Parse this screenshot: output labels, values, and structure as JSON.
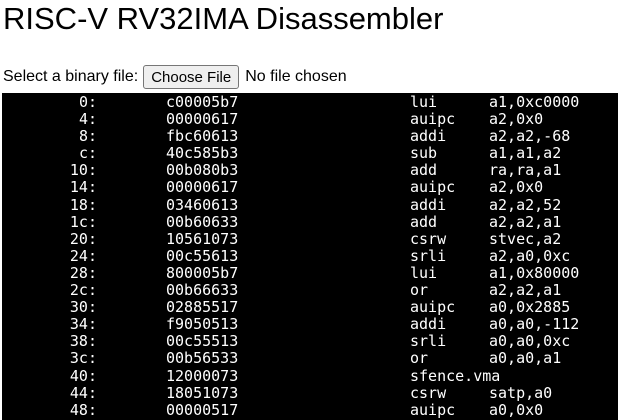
{
  "title": "RISC-V RV32IMA Disassembler",
  "file_input": {
    "label": "Select a binary file:",
    "button_label": "Choose File",
    "status": "No file chosen"
  },
  "colors": {
    "output_background": "#000000",
    "output_text": "#ffffff",
    "button_background": "#efefef"
  },
  "disassembly": [
    {
      "addr": "0:",
      "hex": "c00005b7",
      "mnemonic": "lui",
      "operands": "a1,0xc0000"
    },
    {
      "addr": "4:",
      "hex": "00000617",
      "mnemonic": "auipc",
      "operands": "a2,0x0"
    },
    {
      "addr": "8:",
      "hex": "fbc60613",
      "mnemonic": "addi",
      "operands": "a2,a2,-68"
    },
    {
      "addr": "c:",
      "hex": "40c585b3",
      "mnemonic": "sub",
      "operands": "a1,a1,a2"
    },
    {
      "addr": "10:",
      "hex": "00b080b3",
      "mnemonic": "add",
      "operands": "ra,ra,a1"
    },
    {
      "addr": "14:",
      "hex": "00000617",
      "mnemonic": "auipc",
      "operands": "a2,0x0"
    },
    {
      "addr": "18:",
      "hex": "03460613",
      "mnemonic": "addi",
      "operands": "a2,a2,52"
    },
    {
      "addr": "1c:",
      "hex": "00b60633",
      "mnemonic": "add",
      "operands": "a2,a2,a1"
    },
    {
      "addr": "20:",
      "hex": "10561073",
      "mnemonic": "csrw",
      "operands": "stvec,a2"
    },
    {
      "addr": "24:",
      "hex": "00c55613",
      "mnemonic": "srli",
      "operands": "a2,a0,0xc"
    },
    {
      "addr": "28:",
      "hex": "800005b7",
      "mnemonic": "lui",
      "operands": "a1,0x80000"
    },
    {
      "addr": "2c:",
      "hex": "00b66633",
      "mnemonic": "or",
      "operands": "a2,a2,a1"
    },
    {
      "addr": "30:",
      "hex": "02885517",
      "mnemonic": "auipc",
      "operands": "a0,0x2885"
    },
    {
      "addr": "34:",
      "hex": "f9050513",
      "mnemonic": "addi",
      "operands": "a0,a0,-112"
    },
    {
      "addr": "38:",
      "hex": "00c55513",
      "mnemonic": "srli",
      "operands": "a0,a0,0xc"
    },
    {
      "addr": "3c:",
      "hex": "00b56533",
      "mnemonic": "or",
      "operands": "a0,a0,a1"
    },
    {
      "addr": "40:",
      "hex": "12000073",
      "mnemonic": "sfence.vma",
      "operands": ""
    },
    {
      "addr": "44:",
      "hex": "18051073",
      "mnemonic": "csrw",
      "operands": "satp,a0"
    },
    {
      "addr": "48:",
      "hex": "00000517",
      "mnemonic": "auipc",
      "operands": "a0,0x0"
    }
  ]
}
